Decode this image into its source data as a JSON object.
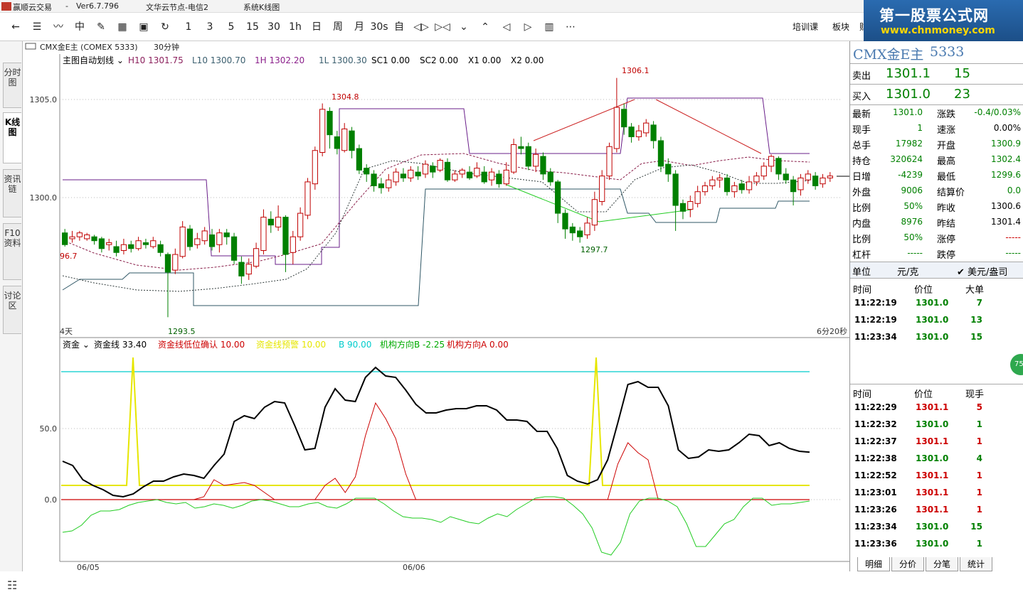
{
  "titlebar": {
    "app": "赢顺云交易",
    "version": "Ver6.7.796",
    "node": "文华云节点-电信2",
    "line_name": "系统K线图"
  },
  "toolbar": {
    "periods": [
      "1",
      "3",
      "5",
      "15",
      "30",
      "1h",
      "日",
      "周",
      "月",
      "30s"
    ],
    "self_label": "自",
    "right_items": [
      "培训课",
      "板块",
      "财"
    ]
  },
  "banner": {
    "title": "第一股票公式网",
    "url": "www.chnmoney.com"
  },
  "left_tabs": [
    "分时图",
    "K线图",
    "资讯链",
    "F10资料",
    "讨论区"
  ],
  "chart": {
    "contract_label": "CMX金E主 (COMEX 5333)",
    "period_label": "30分钟",
    "indicator_bar": {
      "name": "主图自动划线",
      "items": [
        {
          "label": "H10 1301.75",
          "color": "#8b1f5c"
        },
        {
          "label": "L10 1300.70",
          "color": "#3b5f6f"
        },
        {
          "label": "1H 1302.20",
          "color": "#8b1f8b"
        },
        {
          "label": "1L 1300.30",
          "color": "#3b5f6f"
        },
        {
          "label": "SC1 0.00",
          "color": "#000000"
        },
        {
          "label": "SC2 0.00",
          "color": "#000000"
        },
        {
          "label": "X1 0.00",
          "color": "#000000"
        },
        {
          "label": "X2 0.00",
          "color": "#000000"
        }
      ]
    },
    "y_ticks": [
      "1305.0",
      "1300.0"
    ],
    "annotations": {
      "high": "1306.1",
      "low": "1297.7",
      "peak1": "1304.8",
      "left_low": "1293.5",
      "left_edge": "96.7"
    },
    "left_label": "4天",
    "countdown": "6分20秒",
    "sub_bar": {
      "name": "资金",
      "items": [
        {
          "label": "资金线 33.40",
          "color": "#000000"
        },
        {
          "label": "资金线低位确认 10.00",
          "color": "#cc0000"
        },
        {
          "label": "资金线预警 10.00",
          "color": "#e6e600"
        },
        {
          "label": "B 90.00",
          "color": "#00cccc"
        },
        {
          "label": "机构方向B -2.25",
          "color": "#00aa00"
        },
        {
          "label": "机构方向A 0.00",
          "color": "#cc0000"
        }
      ]
    },
    "sub_y_ticks": [
      "50.0",
      "0.0"
    ],
    "x_labels": [
      "06/05",
      "06/06"
    ]
  },
  "chart_data": {
    "type": "candlestick",
    "series": [
      {
        "name": "资金线",
        "values": [
          27,
          24,
          14,
          10,
          7,
          3,
          2,
          4,
          9,
          13,
          13,
          16,
          18,
          17,
          15,
          24,
          32,
          55,
          59,
          57,
          65,
          69,
          68,
          52,
          35,
          36,
          65,
          78,
          70,
          69,
          86,
          93,
          87,
          86,
          77,
          67,
          61,
          61,
          63,
          64,
          64,
          66,
          66,
          63,
          56,
          56,
          55,
          48,
          48,
          36,
          17,
          13,
          11,
          14,
          28,
          54,
          81,
          83,
          79,
          79,
          66,
          35,
          29,
          30,
          35,
          34,
          35,
          40,
          46,
          45,
          38,
          40,
          36,
          34,
          33.4
        ]
      },
      {
        "name": "资金线低位确认",
        "values": [
          0,
          0,
          0,
          0,
          0,
          0,
          0,
          0,
          0,
          0,
          0,
          0,
          0,
          0,
          2,
          14,
          10,
          11,
          12,
          10,
          5,
          0,
          0,
          0,
          0,
          0,
          10,
          15,
          5,
          16,
          45,
          68,
          57,
          43,
          18,
          0,
          0,
          0,
          0,
          0,
          0,
          0,
          0,
          0,
          0,
          0,
          0,
          0,
          0,
          0,
          0,
          0,
          0,
          0,
          0,
          25,
          40,
          33,
          28,
          0,
          0,
          0,
          0,
          0,
          0,
          0,
          0,
          0,
          0,
          0,
          0,
          0,
          0,
          0,
          0
        ]
      }
    ]
  },
  "quote": {
    "title": "CMX金E主",
    "code": "5333",
    "sell": {
      "label": "卖出",
      "price": "1301.1",
      "vol": "15"
    },
    "buy": {
      "label": "买入",
      "price": "1301.0",
      "vol": "23"
    },
    "rows": [
      {
        "l": "最新",
        "v": "1301.0",
        "vc": "#008000",
        "l2": "涨跌",
        "v2": "-0.4/0.03%",
        "v2c": "#008000"
      },
      {
        "l": "现手",
        "v": "1",
        "vc": "#008000",
        "l2": "速涨",
        "v2": "0.00%",
        "v2c": "#000000"
      },
      {
        "l": "总手",
        "v": "17982",
        "vc": "#008000",
        "l2": "开盘",
        "v2": "1300.9",
        "v2c": "#008000"
      },
      {
        "l": "持仓",
        "v": "320624",
        "vc": "#008000",
        "l2": "最高",
        "v2": "1302.4",
        "v2c": "#008000"
      },
      {
        "l": "日增",
        "v": "-4239",
        "vc": "#008000",
        "l2": "最低",
        "v2": "1299.6",
        "v2c": "#008000"
      },
      {
        "l": "外盘",
        "v": "9006",
        "vc": "#008000",
        "l2": "结算价",
        "v2": "0.0",
        "v2c": "#008000"
      },
      {
        "l": "比例",
        "v": "50%",
        "vc": "#008000",
        "l2": "昨收",
        "v2": "1300.6",
        "v2c": "#000000"
      },
      {
        "l": "内盘",
        "v": "8976",
        "vc": "#008000",
        "l2": "昨结",
        "v2": "1301.4",
        "v2c": "#000000"
      },
      {
        "l": "比例",
        "v": "50%",
        "vc": "#008000",
        "l2": "涨停",
        "v2": "-----",
        "v2c": "#cc0000"
      },
      {
        "l": "杠杆",
        "v": "-----",
        "vc": "#008000",
        "l2": "跌停",
        "v2": "-----",
        "v2c": "#008000"
      }
    ],
    "unit_label": "单位",
    "unit_value": "元/克",
    "unit_alt": "✔ 美元/盎司",
    "big_orders": {
      "headers": [
        "时间",
        "价位",
        "大单"
      ],
      "rows": [
        [
          "11:22:19",
          "1301.0",
          "7"
        ],
        [
          "11:22:19",
          "1301.0",
          "13"
        ],
        [
          "11:23:34",
          "1301.0",
          "15"
        ]
      ]
    },
    "ticks": {
      "headers": [
        "时间",
        "价位",
        "现手"
      ],
      "rows": [
        [
          "11:22:29",
          "1301.1",
          "5",
          "#cc0000"
        ],
        [
          "11:22:32",
          "1301.0",
          "1",
          "#008000"
        ],
        [
          "11:22:37",
          "1301.1",
          "1",
          "#cc0000"
        ],
        [
          "11:22:38",
          "1301.0",
          "4",
          "#008000"
        ],
        [
          "11:22:52",
          "1301.1",
          "1",
          "#cc0000"
        ],
        [
          "11:23:01",
          "1301.1",
          "1",
          "#cc0000"
        ],
        [
          "11:23:26",
          "1301.1",
          "1",
          "#cc0000"
        ],
        [
          "11:23:34",
          "1301.0",
          "15",
          "#008000"
        ],
        [
          "11:23:36",
          "1301.0",
          "1",
          "#008000"
        ]
      ]
    },
    "bottom_tabs": [
      "明细",
      "分价",
      "分笔",
      "统计"
    ],
    "badge": "75"
  }
}
